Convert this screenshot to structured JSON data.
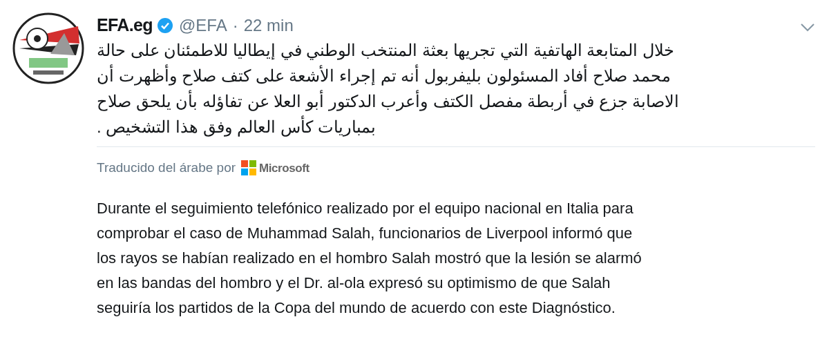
{
  "tweet": {
    "display_name": "EFA.eg",
    "verified": true,
    "handle": "@EFA",
    "separator": "·",
    "time": "22 min",
    "original_lines": [
      "خلال المتابعة الهاتفية التي تجريها بعثة المنتخب الوطني في إيطاليا للاطمئنان على حالة",
      "محمد صلاح أفاد المسئولون بليفربول أنه تم إجراء الأشعة على كتف صلاح وأظهرت أن",
      "الاصابة جزع في أربطة مفصل الكتف وأعرب الدكتور أبو العلا عن تفاؤله بأن يلحق صلاح",
      "بمباريات كأس العالم وفق هذا التشخيص ."
    ],
    "translation_label": "Traducido del árabe por",
    "translator": "Microsoft",
    "translation_lines": [
      "Durante el seguimiento telefónico realizado por el equipo nacional en Italia para",
      "comprobar el caso de Muhammad Salah, funcionarios de Liverpool informó que",
      "los rayos se habían realizado en el hombro Salah mostró que la lesión se alarmó",
      "en las bandas del hombro y el Dr. al-ola expresó su optimismo de que Salah",
      "seguiría los partidos de la Copa del mundo de acuerdo con este Diagnóstico."
    ]
  }
}
